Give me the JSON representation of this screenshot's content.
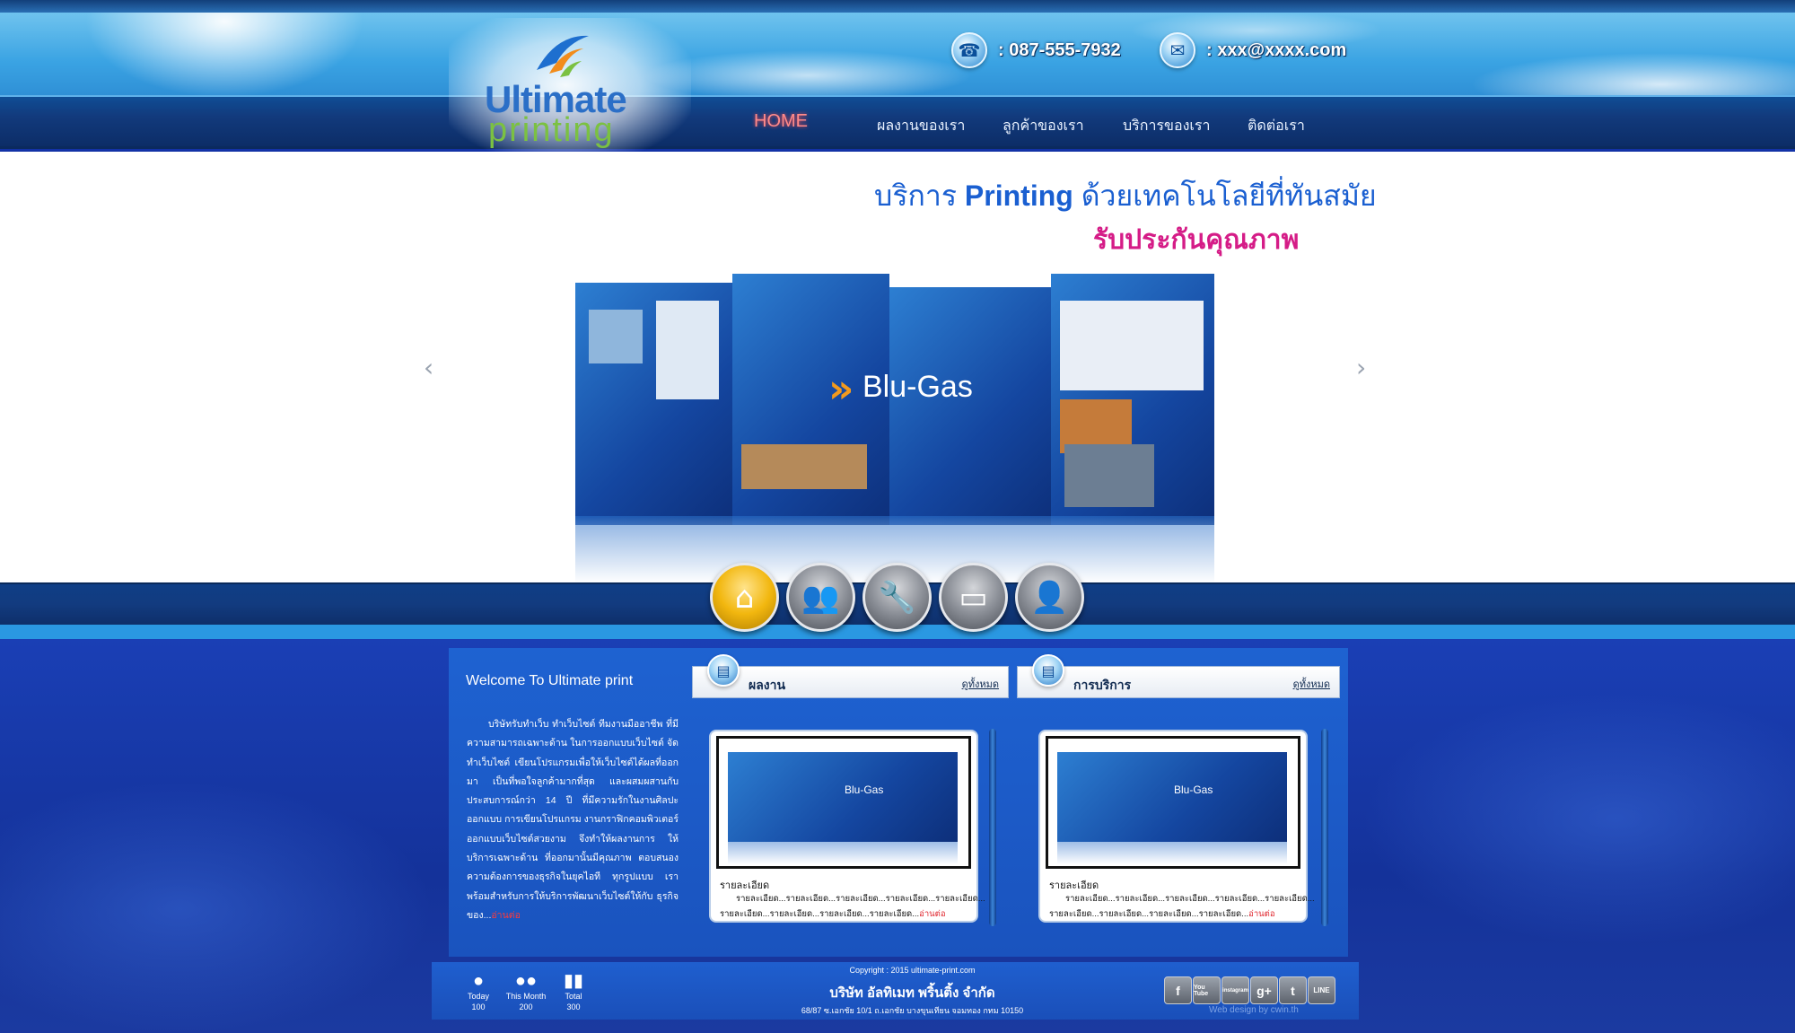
{
  "header": {
    "phone": ": 087-555-7932",
    "email": ": xxx@xxxx.com",
    "logo_top": "Ultimate",
    "logo_bottom": "printing"
  },
  "nav": [
    {
      "label": "HOME",
      "active": true
    },
    {
      "label": "ผลงานของเรา",
      "active": false
    },
    {
      "label": "ลูกค้าของเรา",
      "active": false
    },
    {
      "label": "บริการของเรา",
      "active": false
    },
    {
      "label": "ติดต่อเรา",
      "active": false
    }
  ],
  "slider": {
    "tagline_prefix": "บริการ",
    "tagline_brand": "Printing",
    "tagline_suffix": "ด้วยเทคโนโลยีที่ทันสมัย",
    "tagline2": "รับประกันคุณภาพ",
    "brochure_text": "Blu-Gas",
    "prev_icon": "‹",
    "next_icon": "›"
  },
  "quick_icons": [
    "home-icon",
    "users-icon",
    "tools-icon",
    "card-icon",
    "person-icon"
  ],
  "welcome": {
    "title": "Welcome To Ultimate print",
    "body": "บริษัทรับทำเว็บ ทำเว็บไซต์ ทีมงานมืออาชีพ ที่มีความสามารถเฉพาะด้าน ในการออกแบบเว็บไซต์ จัดทำเว็บไซต์ เขียนโปรแกรมเพื่อให้เว็บไซต์ได้ผลที่ออกมา เป็นที่พอใจลูกค้ามากที่สุด และผสมผสานกับประสบการณ์กว่า 14 ปี ที่มีความรักในงานศิลปะออกแบบ การเขียนโปรแกรม งานกราฟิกคอมพิวเตอร์ ออกแบบเว็บไซต์สวยงาม จึงทำให้ผลงานการ ให้บริการเฉพาะด้าน ที่ออกมานั้นมีคุณภาพ ตอบสนองความต้องการของธุรกิจในยุคไอที ทุกรูปแบบ เราพร้อมสำหรับการให้บริการพัฒนาเว็บไซต์ให้กับ ธุรกิจของ...",
    "more": "อ่านต่อ"
  },
  "sections": {
    "work": {
      "title": "ผลงาน",
      "view_all": "ดูทั้งหมด",
      "card": {
        "thumb_text": "Blu-Gas",
        "title": "รายละเอียด",
        "line1": "รายละเอียด...รายละเอียด...รายละเอียด...รายละเอียด...รายละเอียด...",
        "line2": "รายละเอียด...รายละเอียด...รายละเอียด...รายละเอียด...",
        "more": "อ่านต่อ"
      }
    },
    "service": {
      "title": "การบริการ",
      "view_all": "ดูทั้งหมด",
      "card": {
        "thumb_text": "Blu-Gas",
        "title": "รายละเอียด",
        "line1": "รายละเอียด...รายละเอียด...รายละเอียด...รายละเอียด...รายละเอียด...",
        "line2": "รายละเอียด...รายละเอียด...รายละเอียด...รายละเอียด...",
        "more": "อ่านต่อ"
      }
    }
  },
  "footer": {
    "stats": [
      {
        "label": "Today",
        "value": "100"
      },
      {
        "label": "This Month",
        "value": "200"
      },
      {
        "label": "Total",
        "value": "300"
      }
    ],
    "copyright": "Copyright : 2015 ultimate-print.com",
    "company": "บริษัท อัลทิเมท พริ้นติ้ง จำกัด",
    "address": "68/87 ซ.เอกชัย 10/1 ถ.เอกชัย บางขุนเทียน จอมทอง กทม 10150",
    "social": [
      "f",
      "You Tube",
      "instagram",
      "g+",
      "t",
      "LINE"
    ],
    "designer": "Web design by cwin.th"
  },
  "colors": {
    "accent": "#1a5fd1",
    "tagline2": "#d51c87",
    "active_nav": "#ff8a8a",
    "read_more": "#e0262e"
  }
}
